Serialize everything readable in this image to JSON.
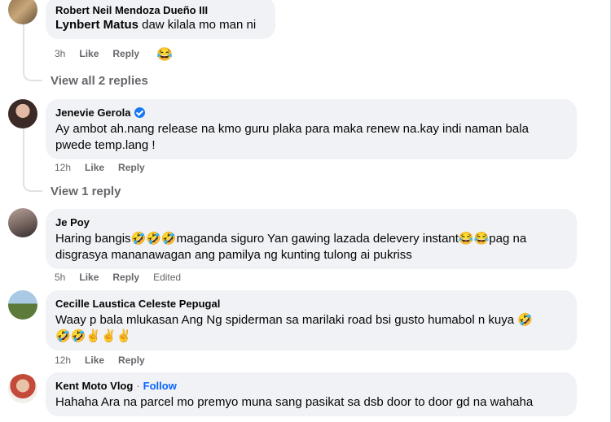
{
  "comments": [
    {
      "author": "Robert Neil Mendoza Dueño III",
      "mention": "Lynbert Matus",
      "text": " daw kilala mo man ni",
      "time": "3h",
      "like": "Like",
      "reply": "Reply",
      "reaction_emoji": "😂",
      "view_replies": "View all 2 replies"
    },
    {
      "author": "Jenevie Gerola",
      "verified": true,
      "text_line1": "Ay ambot ah.nang release na kmo guru plaka para maka renew na.kay indi naman bala",
      "text_line2": "pwede temp.lang !",
      "time": "12h",
      "like": "Like",
      "reply": "Reply",
      "view_replies": "View 1 reply"
    },
    {
      "author": "Je Poy",
      "text_line1": "Haring bangis🤣🤣🤣maganda siguro Yan gawing lazada delevery instant😂😂pag na",
      "text_line2": "disgrasya mananawagan ang pamilya ng kunting tulong ai pukriss",
      "time": "5h",
      "like": "Like",
      "reply": "Reply",
      "edited": "Edited"
    },
    {
      "author": "Cecille Laustica Celeste Pepugal",
      "text_line1": "Waay p bala mlukasan Ang Ng spiderman sa marilaki road bsi gusto humabol n kuya 🤣",
      "text_line2": "🤣🤣✌️✌️✌️",
      "time": "12h",
      "like": "Like",
      "reply": "Reply"
    },
    {
      "author": "Kent Moto Vlog",
      "separator": "·",
      "follow": "Follow",
      "text": "Hahaha Ara na parcel mo premyo muna sang pasikat sa dsb door to door gd na wahaha"
    }
  ]
}
